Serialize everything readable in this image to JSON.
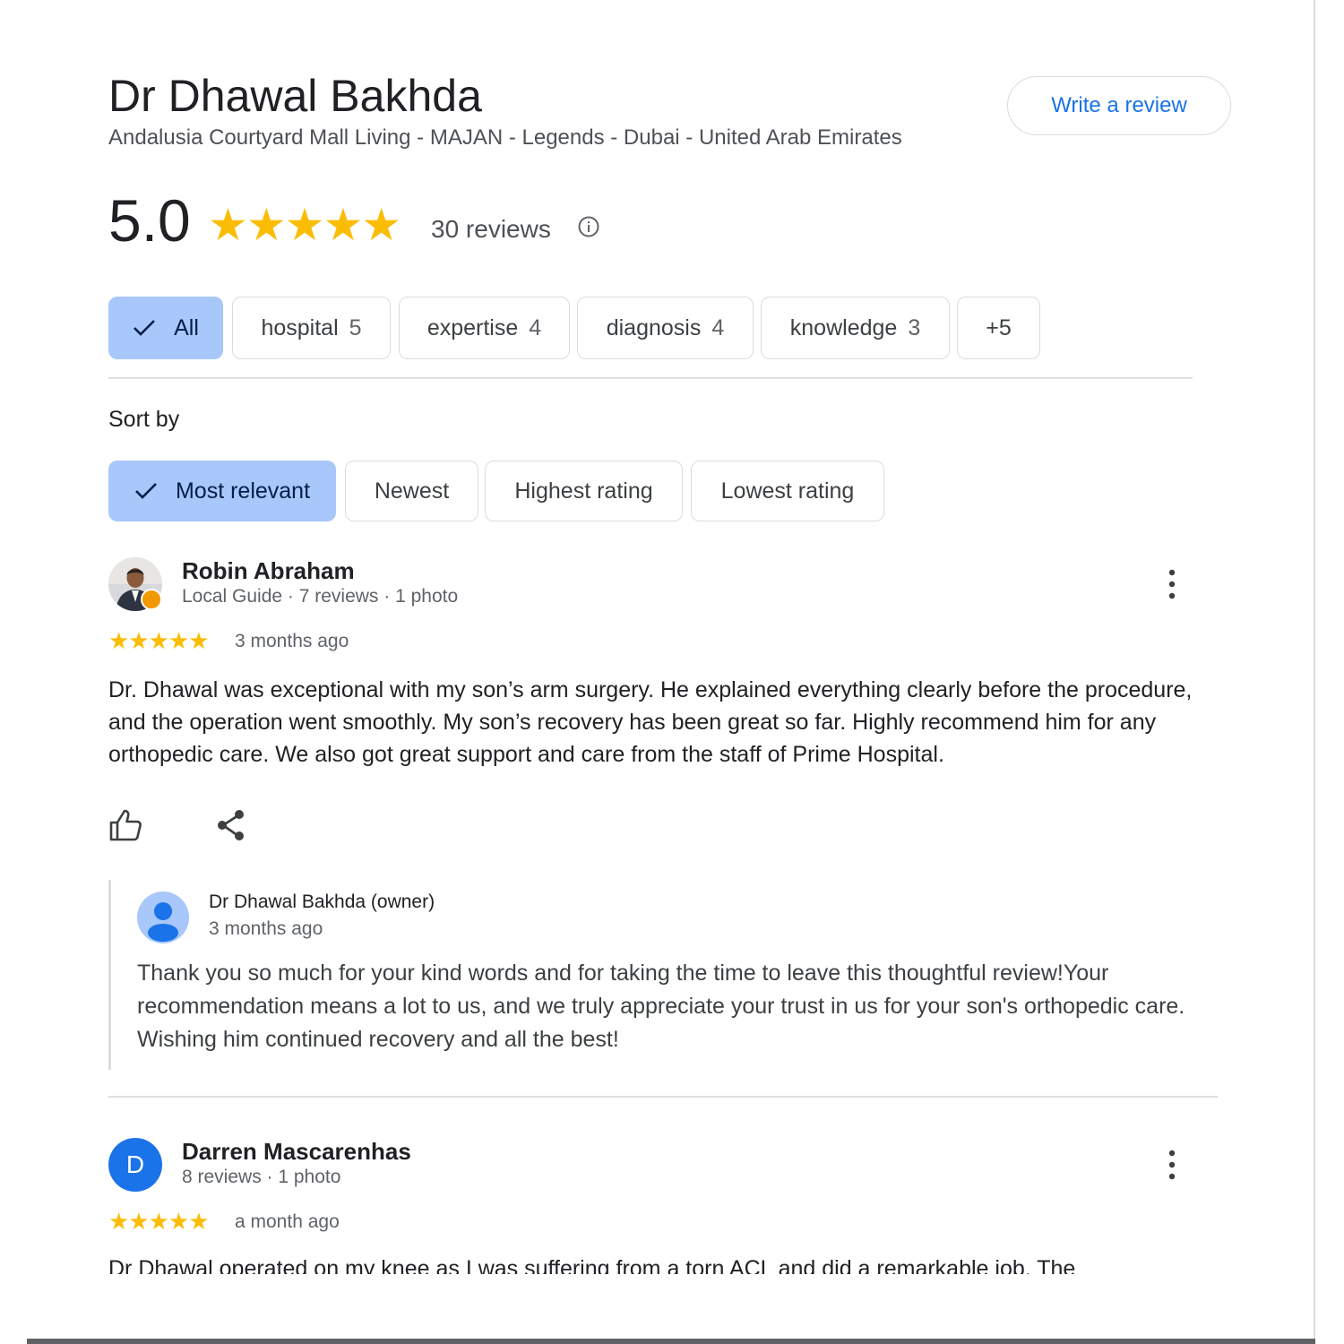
{
  "place": {
    "title": "Dr Dhawal Bakhda",
    "address": "Andalusia Courtyard Mall Living - MAJAN - Legends - Dubai - United Arab Emirates",
    "write_review_label": "Write a review"
  },
  "rating": {
    "score": "5.0",
    "stars": "★★★★★",
    "stars_value": 5,
    "review_count": "30 reviews"
  },
  "topic_chips": [
    {
      "label": "All",
      "count": "",
      "selected": true
    },
    {
      "label": "hospital",
      "count": "5",
      "selected": false
    },
    {
      "label": "expertise",
      "count": "4",
      "selected": false
    },
    {
      "label": "diagnosis",
      "count": "4",
      "selected": false
    },
    {
      "label": "knowledge",
      "count": "3",
      "selected": false
    },
    {
      "label": "+5",
      "count": "",
      "selected": false
    }
  ],
  "sort": {
    "label": "Sort by",
    "options": [
      {
        "label": "Most relevant",
        "selected": true
      },
      {
        "label": "Newest",
        "selected": false
      },
      {
        "label": "Highest rating",
        "selected": false
      },
      {
        "label": "Lowest rating",
        "selected": false
      }
    ]
  },
  "reviews": [
    {
      "name": "Robin Abraham",
      "meta": "Local Guide · 7 reviews · 1 photo",
      "stars": "★★★★★",
      "stars_value": 5,
      "time": "3 months ago",
      "text": "Dr. Dhawal was exceptional with my son’s arm surgery. He explained everything clearly before the procedure, and the operation went smoothly. My son’s recovery has been great so far. Highly recommend him for any orthopedic care. We also got great support and care from the staff of Prime Hospital.",
      "owner_reply": {
        "name": "Dr Dhawal Bakhda (owner)",
        "time": "3 months ago",
        "text": "Thank you so much for your kind words and for taking the time to leave this thoughtful review!Your recommendation means a lot to us, and we truly appreciate your trust in us for your son's orthopedic care. Wishing him continued recovery and all the best!"
      }
    },
    {
      "name": "Darren Mascarenhas",
      "avatar_letter": "D",
      "meta": "8 reviews · 1 photo",
      "stars": "★★★★★",
      "stars_value": 5,
      "time": "a month ago",
      "text": "Dr Dhawal operated on my knee as I was suffering from a torn ACL and did a remarkable job. The"
    }
  ],
  "colors": {
    "accent_blue": "#1a73e8",
    "star_yellow": "#fbbc04",
    "chip_selected": "#a8c7fa",
    "local_guide_badge": "#f29900"
  },
  "icons": [
    "info-icon",
    "check-icon",
    "more-vert-icon",
    "thumb-up-icon",
    "share-icon",
    "person-icon"
  ]
}
